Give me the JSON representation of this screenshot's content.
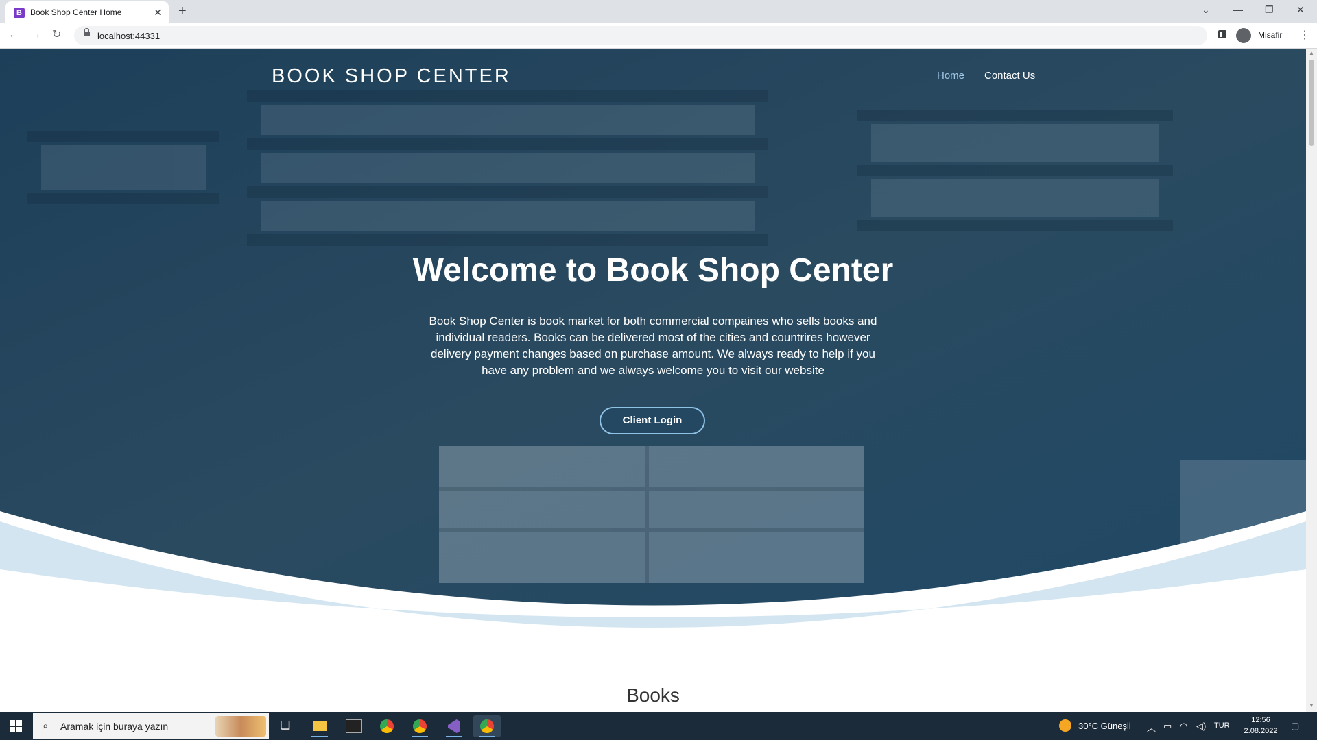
{
  "browser": {
    "tab_title": "Book Shop Center Home",
    "url": "localhost:44331",
    "profile_name": "Misafir"
  },
  "site": {
    "brand": "BOOK SHOP CENTER",
    "nav": [
      {
        "label": "Home",
        "active": true
      },
      {
        "label": "Contact Us",
        "active": false
      }
    ],
    "hero": {
      "title": "Welcome to Book Shop Center",
      "description": "Book Shop Center is book market for both commercial compaines who sells books and individual readers. Books can be delivered most of the cities and countrires however delivery payment changes based on purchase amount. We always ready to help if you have any problem and we always welcome you to visit our website",
      "button_label": "Client Login"
    },
    "section_title": "Books"
  },
  "taskbar": {
    "search_placeholder": "Aramak için buraya yazın",
    "weather": "30°C  Güneşli",
    "language": "TUR",
    "time": "12:56",
    "date": "2.08.2022"
  },
  "colors": {
    "hero_overlay": "#1f4866",
    "wave_light": "#d3e5f0",
    "nav_active": "#9fc8e8",
    "button_border": "#8fc3e6"
  }
}
